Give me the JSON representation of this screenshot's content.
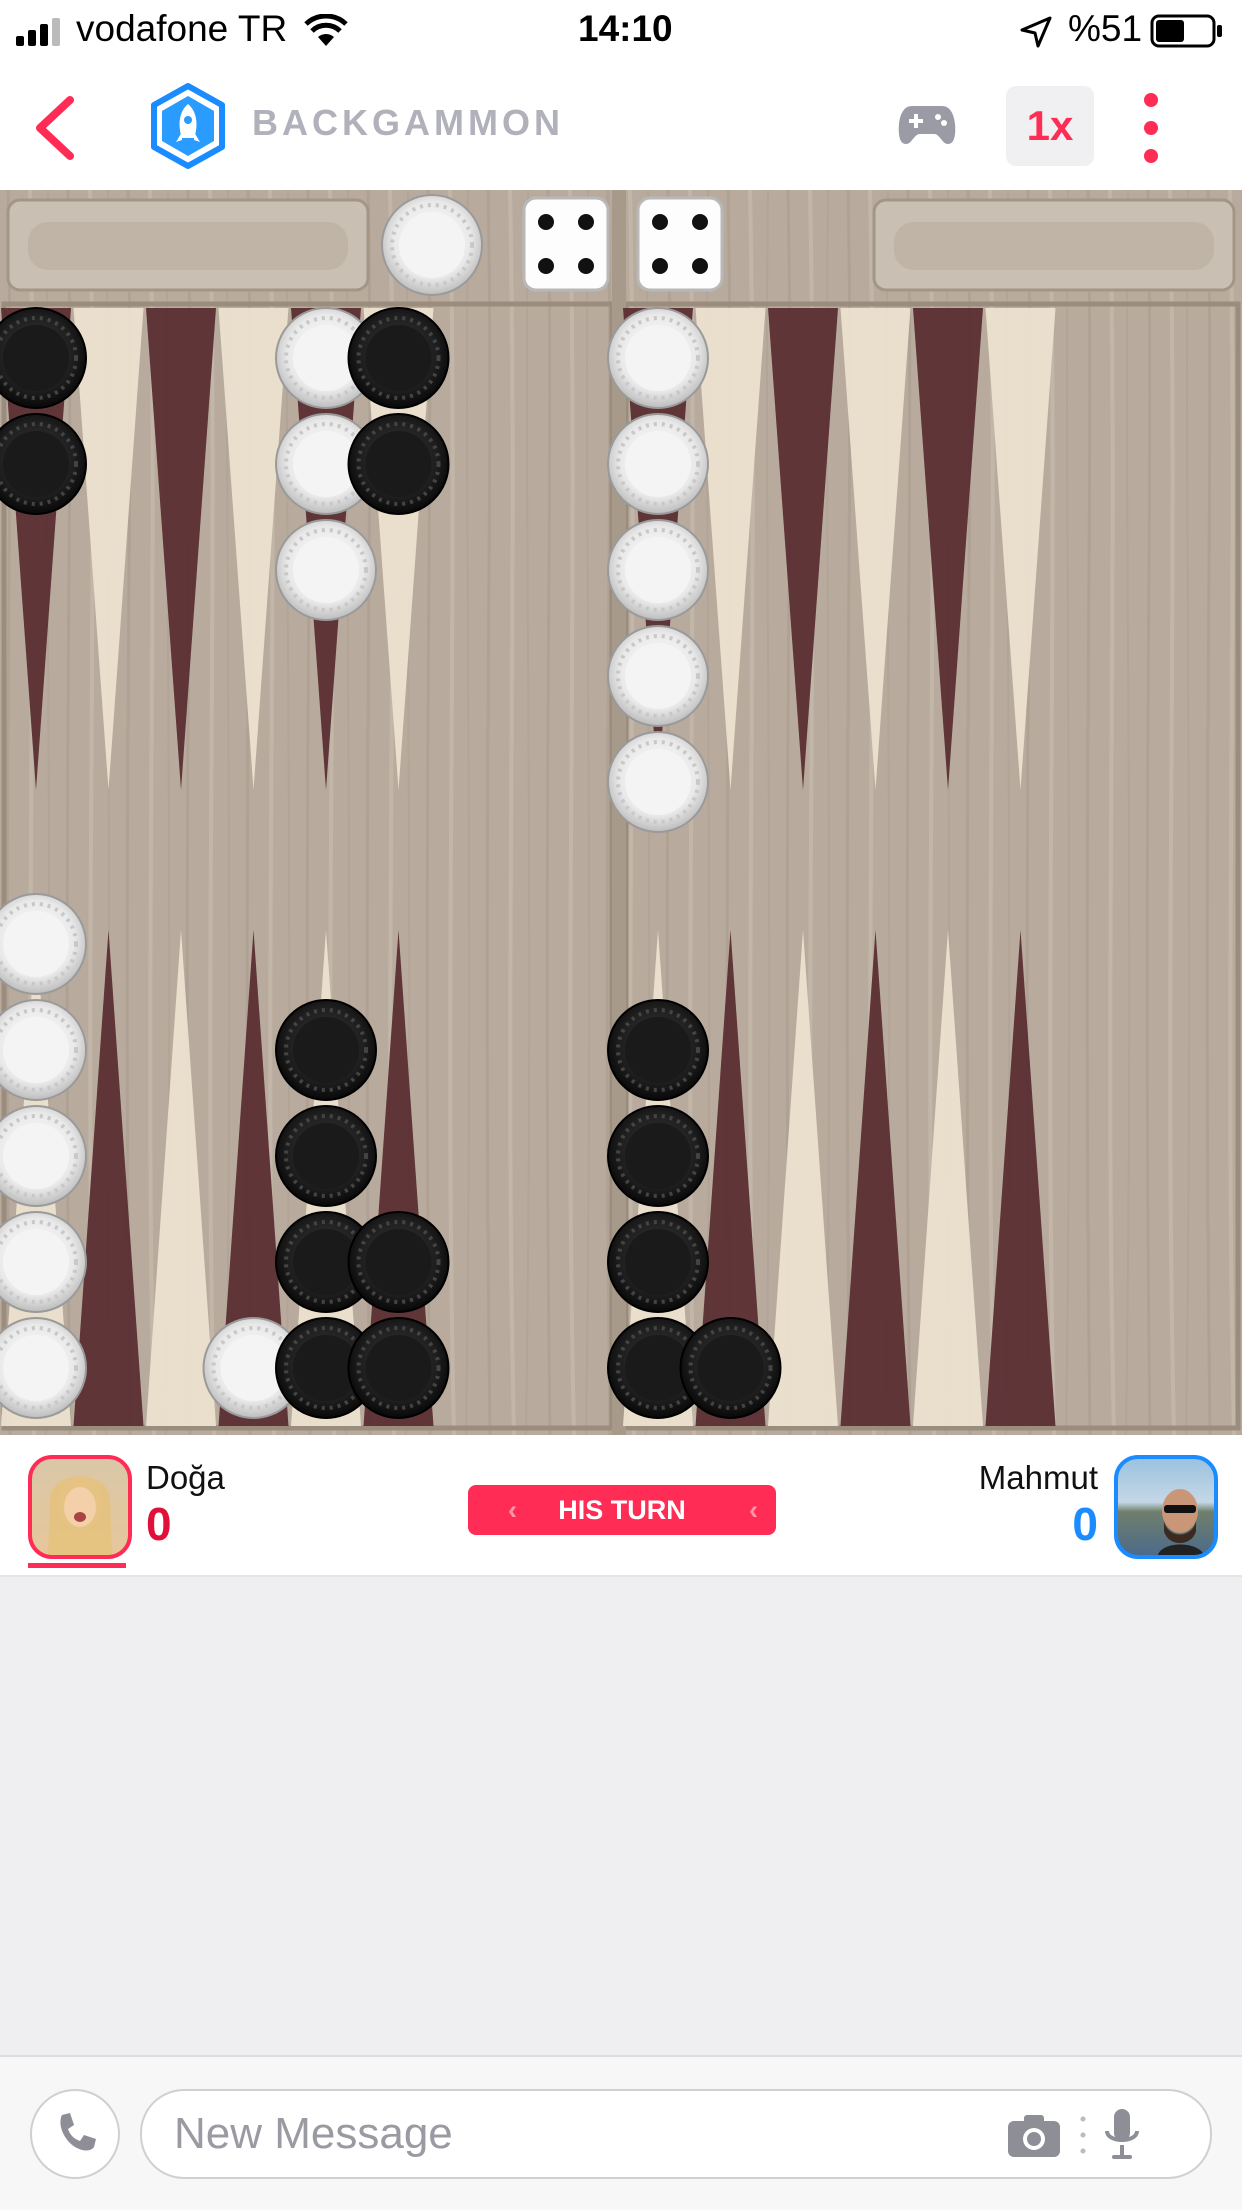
{
  "status_bar": {
    "carrier": "vodafone TR",
    "time": "14:10",
    "battery": "%51",
    "battery_level": 0.51
  },
  "nav": {
    "back_icon": "chevron-left-icon",
    "app_icon": "rocket-icon",
    "title": "BACKGAMMON",
    "controller_icon": "gamepad-icon",
    "speed": "1x",
    "more_icon": "vertical-dots-icon"
  },
  "game": {
    "dice": [
      4,
      4
    ],
    "checkers_top": [
      {
        "point": 13,
        "color": "black",
        "count": 2
      },
      {
        "point": 17,
        "color": "white",
        "count": 3
      },
      {
        "point": 18,
        "color": "black",
        "count": 2
      },
      {
        "point": 19,
        "color": "white",
        "count": 5
      }
    ],
    "checkers_bottom": [
      {
        "point": 12,
        "color": "white",
        "count": 5
      },
      {
        "point": 9,
        "color": "white",
        "count": 1
      },
      {
        "point": 8,
        "color": "black",
        "count": 4
      },
      {
        "point": 7,
        "color": "black",
        "count": 2
      },
      {
        "point": 6,
        "color": "black",
        "count": 4
      },
      {
        "point": 5,
        "color": "black",
        "count": 1
      }
    ],
    "bar_white": 1
  },
  "colors": {
    "accent": "#ff2d55",
    "blue": "#1a8cff",
    "dark_point": "#5a2e33",
    "light_point": "#ece2cf",
    "wood": "#b8ab9d"
  },
  "players": {
    "left": {
      "name": "Doğa",
      "score": "0"
    },
    "right": {
      "name": "Mahmut",
      "score": "0"
    },
    "turn_label": "HIS TURN"
  },
  "composer": {
    "phone_icon": "phone-icon",
    "placeholder": "New Message",
    "camera_icon": "camera-icon",
    "mic_icon": "microphone-icon"
  }
}
